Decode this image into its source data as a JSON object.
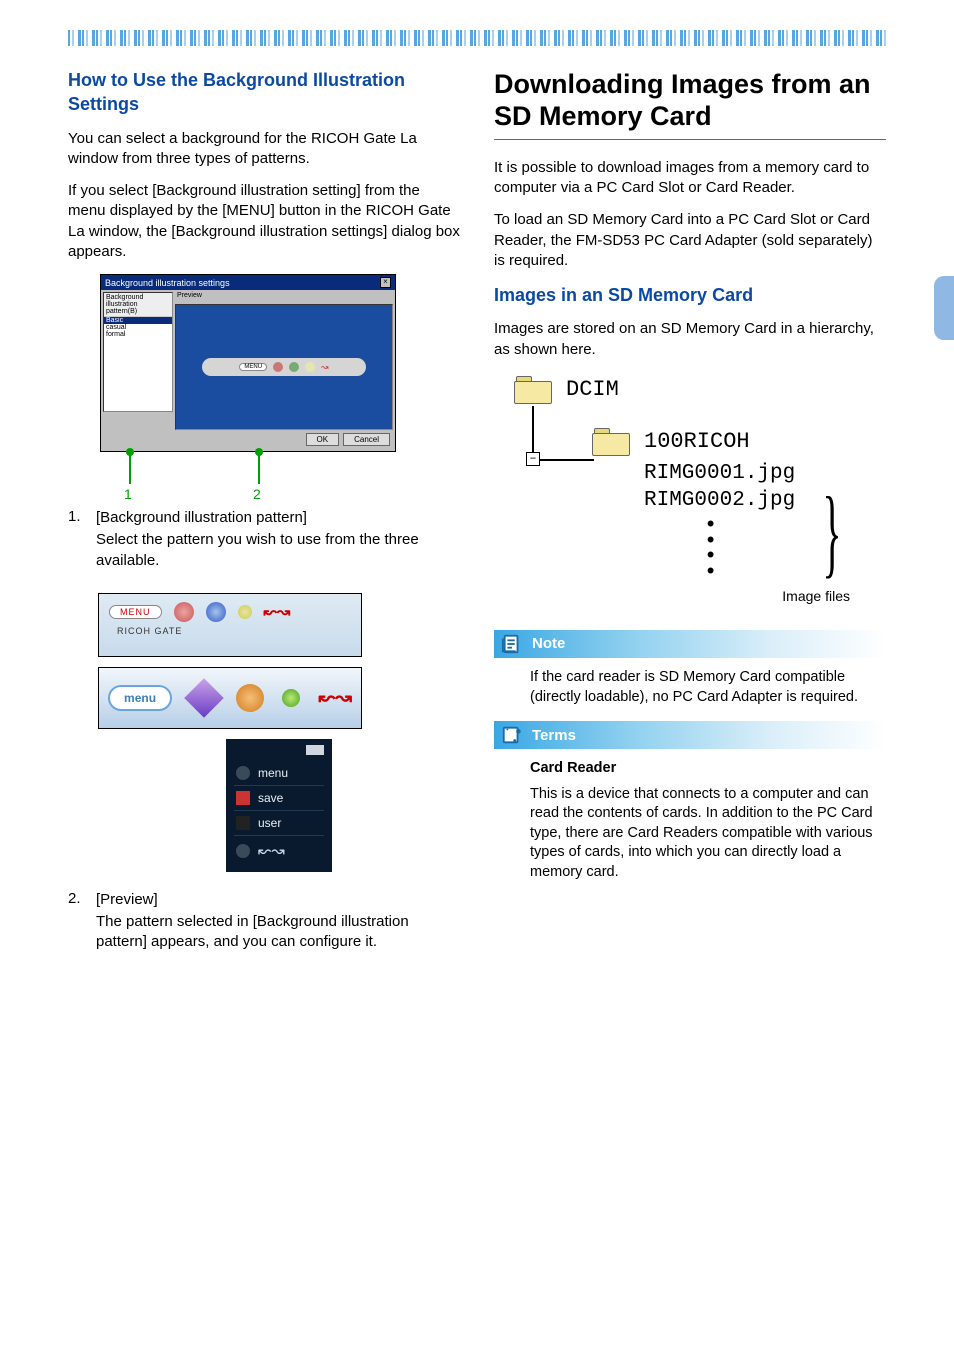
{
  "left": {
    "heading": "How to Use the Background Illustration Settings",
    "p1": "You can select a background for the RICOH Gate La window from three types of patterns.",
    "p2": "If you select [Background illustration setting] from the menu displayed by the [MENU] button in the RICOH Gate La window, the [Background illustration settings] dialog box appears.",
    "dialog": {
      "title": "Background illustration settings",
      "left_header": "Background illustration pattern(B)",
      "right_header": "Preview",
      "items": [
        "Basic",
        "casual",
        "formal"
      ],
      "ok": "OK",
      "cancel": "Cancel",
      "menu_label": "MENU"
    },
    "callout1": "1",
    "callout2": "2",
    "item1_num": "1.",
    "item1_title": "[Background illustration pattern]",
    "item1_body": "Select the pattern you wish to use from the three available.",
    "pat1": {
      "menu": "MENU",
      "brand": "RICOH GATE"
    },
    "pat2": {
      "menu": "menu"
    },
    "pat3": {
      "r1": "menu",
      "r2": "save",
      "r3": "user"
    },
    "item2_num": "2.",
    "item2_title": "[Preview]",
    "item2_body": "The pattern selected in [Background illustration pattern] appears, and you can configure it."
  },
  "right": {
    "heading": "Downloading Images from an SD Memory Card",
    "p1": "It is possible to download images from a memory card to computer via a PC Card Slot or Card Reader.",
    "p2": "To load an SD Memory Card into a PC Card Slot or Card Reader, the FM-SD53 PC Card Adapter (sold separately) is required.",
    "subhead": "Images in an SD Memory Card",
    "p3": "Images are stored on an SD Memory Card in a hierarchy, as shown here.",
    "hierarchy": {
      "root": "DCIM",
      "folder": "100RICOH",
      "file1": "RIMG0001.jpg",
      "file2": "RIMG0002.jpg",
      "minus": "–",
      "label": "Image files"
    },
    "note": {
      "title": "Note",
      "body": "If the card reader is SD Memory Card compatible (directly loadable), no PC Card Adapter is required."
    },
    "terms": {
      "title": "Terms",
      "term": "Card Reader",
      "body": "This is a device that connects to a computer and can read the contents of cards. In addition to the PC Card type, there are Card Readers compatible with various types of cards, into which you can directly load a memory card."
    }
  }
}
